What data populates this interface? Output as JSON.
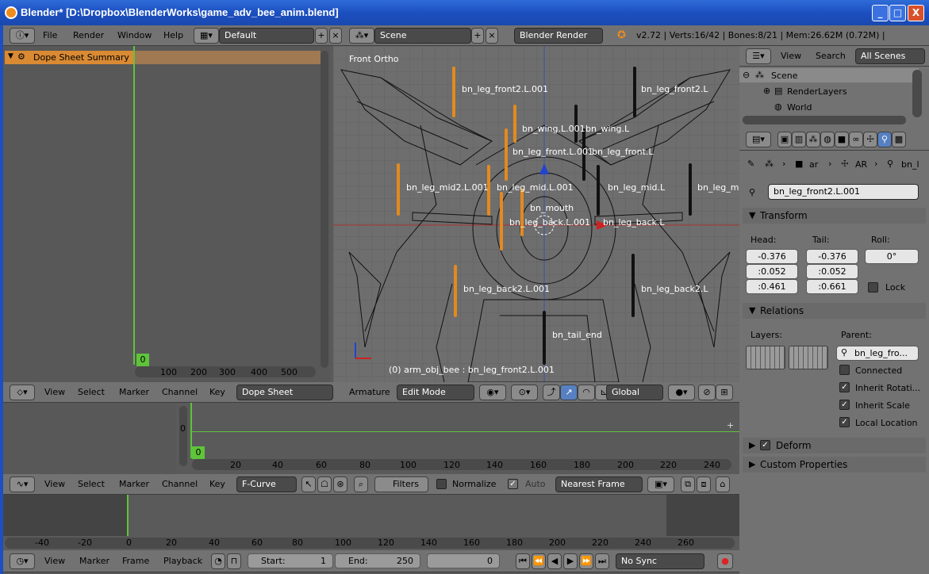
{
  "window": {
    "title": "Blender* [D:\\Dropbox\\BlenderWorks\\game_adv_bee_anim.blend]",
    "min": "_",
    "max": "□",
    "close": "X"
  },
  "topbar": {
    "menus": [
      "File",
      "Render",
      "Window",
      "Help"
    ],
    "layout": "Default",
    "scene": "Scene",
    "engine": "Blender Render",
    "stats": "v2.72 | Verts:16/42 | Bones:8/21 | Mem:26.62M (0.72M) | arm_obj_bee"
  },
  "dopesheet": {
    "channel": "Dope Sheet Summary",
    "frame": "0",
    "ticks": [
      "100",
      "200",
      "300",
      "400",
      "500"
    ],
    "menus": [
      "View",
      "Select",
      "Marker",
      "Channel",
      "Key"
    ],
    "mode": "Dope Sheet"
  },
  "viewport": {
    "view_label": "Front Ortho",
    "status": "(0) arm_obj_bee : bn_leg_front2.L.001",
    "bones": [
      "bn_leg_front2.L.001",
      "bn_leg_front2.L",
      "bn_wing.L.001",
      "bn_wing.L",
      "bn_leg_front.L.001",
      "bn_leg_front.L",
      "bn_leg_mid2.L.001",
      "bn_leg_mid.L.001",
      "bn_leg_mid.L",
      "bn_leg_mid",
      "bn_mouth",
      "bn_leg_back.L.001",
      "bn_leg_back.L",
      "bn_leg_back2.L.001",
      "bn_leg_back2.L",
      "bn_tail_end"
    ],
    "header": {
      "type": "Armature",
      "mode": "Edit Mode",
      "orientation": "Global"
    }
  },
  "outliner": {
    "menus": [
      "View",
      "Search"
    ],
    "filter": "All Scenes",
    "items": [
      "Scene",
      "RenderLayers",
      "World"
    ]
  },
  "properties": {
    "breadcrumb": [
      "ar",
      "AR",
      "bn_l"
    ],
    "bone_name": "bn_leg_front2.L.001",
    "transform": {
      "title": "Transform",
      "head_label": "Head:",
      "tail_label": "Tail:",
      "roll_label": "Roll:",
      "head": [
        "-0.376",
        ":0.052",
        ":0.461"
      ],
      "tail": [
        "-0.376",
        ":0.052",
        ":0.661"
      ],
      "roll": "0°",
      "lock": "Lock"
    },
    "relations": {
      "title": "Relations",
      "layers_label": "Layers:",
      "parent_label": "Parent:",
      "parent": "bn_leg_fro...",
      "connected": "Connected",
      "inherit_rot": "Inherit Rotati...",
      "inherit_scale": "Inherit Scale",
      "local_location": "Local Location"
    },
    "deform": "Deform",
    "custom": "Custom Properties"
  },
  "graph": {
    "frame": "0",
    "yzero": "0",
    "ticks": [
      "20",
      "40",
      "60",
      "80",
      "100",
      "120",
      "140",
      "160",
      "180",
      "200",
      "220",
      "240"
    ],
    "menus": [
      "View",
      "Select",
      "Marker",
      "Channel",
      "Key"
    ],
    "mode": "F-Curve",
    "filters": "Filters",
    "normalize": "Normalize",
    "auto": "Auto",
    "snap": "Nearest Frame"
  },
  "nla": {
    "ticks": [
      "-40",
      "-20",
      "0",
      "20",
      "40",
      "60",
      "80",
      "100",
      "120",
      "140",
      "160",
      "180",
      "200",
      "220",
      "240",
      "260"
    ]
  },
  "timeline": {
    "menus": [
      "View",
      "Marker",
      "Frame",
      "Playback"
    ],
    "start": "Start:",
    "start_val": "1",
    "end": "End:",
    "end_val": "250",
    "current": "0",
    "sync": "No Sync"
  }
}
